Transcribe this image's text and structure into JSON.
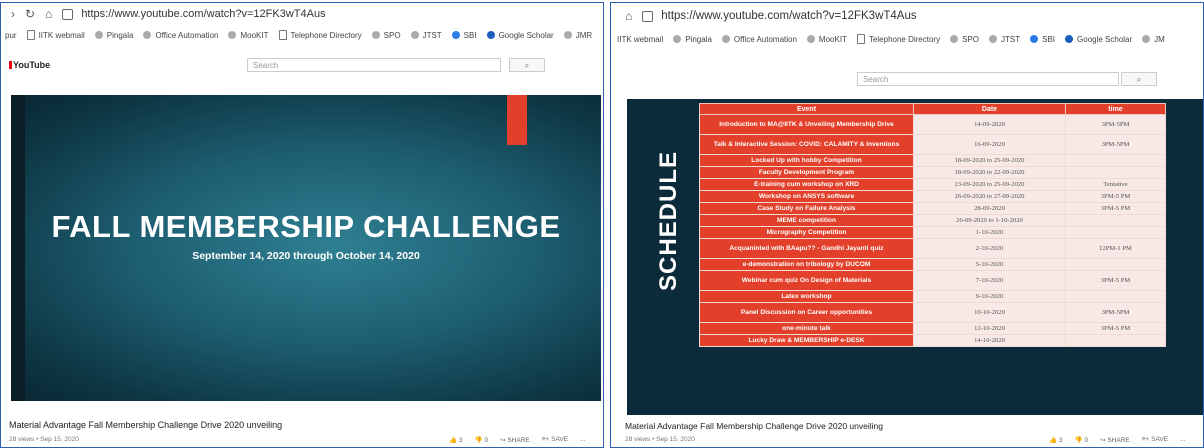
{
  "left": {
    "address": {
      "url": "https://www.youtube.com/watch?v=12FK3wT4Aus"
    },
    "bookmarks": [
      "IITK webmail",
      "Pingala",
      "Office Automation",
      "MooKIT",
      "Telephone Directory",
      "SPO",
      "JTST",
      "SBI",
      "Google Scholar",
      "JMR"
    ],
    "bookmark_prefix": "pur",
    "youtube_logo": "YouTube",
    "search_placeholder": "Search",
    "video": {
      "title": "FALL MEMBERSHIP CHALLENGE",
      "subtitle": "September 14, 2020 through October 14, 2020"
    },
    "video_title": "Material Advantage Fall Membership Challenge Drive 2020 unveiling",
    "meta": "28 views • Sep 15, 2020",
    "actions": {
      "like": "3",
      "dislike": "0",
      "share": "SHARE",
      "save": "SAVE",
      "more": "..."
    }
  },
  "right": {
    "address": {
      "url": "https://www.youtube.com/watch?v=12FK3wT4Aus"
    },
    "bookmarks": [
      "IITK webmail",
      "Pingala",
      "Office Automation",
      "MooKIT",
      "Telephone Directory",
      "SPO",
      "JTST",
      "SBI",
      "Google Scholar",
      "JM"
    ],
    "search_placeholder": "Search",
    "schedule_label": "SCHEDULE",
    "headers": [
      "Event",
      "Date",
      "time"
    ],
    "rows": [
      [
        "Introduction to MA@IITK & Unveiling Membership Drive",
        "14-09-2020",
        "3PM-5PM"
      ],
      [
        "Talk & Interactive Session: COVID: CALAMITY & Inventions",
        "16-09-2020",
        "3PM-5PM"
      ],
      [
        "Locked Up with hobby Competition",
        "18-09-2020 to 25-09-2020",
        ""
      ],
      [
        "Faculty Development Program",
        "18-09-2020 to 22-09-2020",
        ""
      ],
      [
        "E-training cum workshop on XRD",
        "23-09-2020 to 25-09-2020",
        "Tentative"
      ],
      [
        "Workshop on ANSYS software",
        "26-09-2020 to 27-09-2020",
        "3PM-5 PM"
      ],
      [
        "Case Study on Failure Analysis",
        "28-09-2020",
        "3PM-5 PM"
      ],
      [
        "MEME competition",
        "26-09-2020 to 1-10-2020",
        ""
      ],
      [
        "Micrography Competition",
        "1-10-2020",
        ""
      ],
      [
        "Acquaninted with BAapu?? - Gandhi Jayanti quiz",
        "2-10-2020",
        "12PM-1 PM"
      ],
      [
        "e-demonstration on tribology by DUCOM",
        "5-10-2020",
        ""
      ],
      [
        "Webinar cum quiz On Design of Materials",
        "7-10-2020",
        "3PM-5 PM"
      ],
      [
        "Latex workshop",
        "9-10-2020",
        ""
      ],
      [
        "Panel Discussion on Career opportunities",
        "10-10-2020",
        "3PM-5PM"
      ],
      [
        "one-minute talk",
        "12-10-2020",
        "3PM-5 PM"
      ],
      [
        "Lucky Draw & MEMBERSHIP e-DESK",
        "14-10-2020",
        ""
      ]
    ],
    "video_title": "Material Advantage Fall Membership Challenge Drive 2020 unveiling",
    "meta": "28 views • Sep 15, 2020",
    "actions": {
      "like": "3",
      "dislike": "0",
      "share": "SHARE",
      "save": "SAVE",
      "more": "..."
    }
  }
}
